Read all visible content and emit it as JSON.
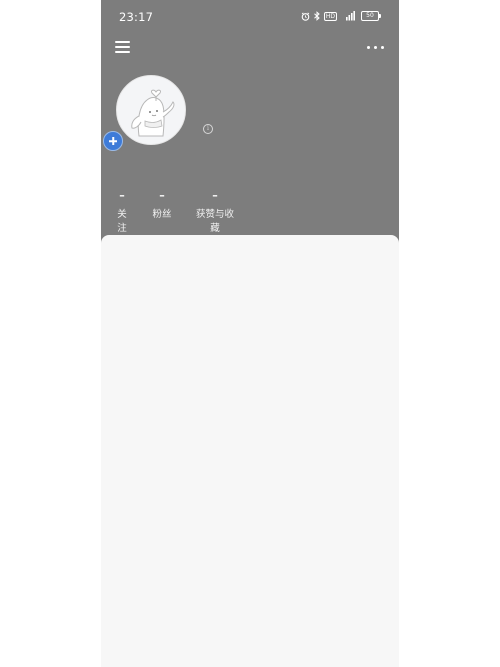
{
  "status_bar": {
    "time": "23:17",
    "hd_label": "HD",
    "network_label": "4G",
    "battery_level": "50"
  },
  "top_bar": {
    "menu_icon": "hamburger-menu-icon",
    "more_icon": "more-dots-icon"
  },
  "profile": {
    "avatar_icon": "default-avatar-illustration",
    "add_icon": "plus-icon",
    "info_icon": "info-icon"
  },
  "stats": [
    {
      "value": "–",
      "label": "关注"
    },
    {
      "value": "–",
      "label": "粉丝"
    },
    {
      "value": "–",
      "label": "获赞与收藏"
    }
  ],
  "colors": {
    "header_bg": "#7d7d7d",
    "panel_bg": "#f7f7f7",
    "badge_blue": "#3e7bd8"
  }
}
